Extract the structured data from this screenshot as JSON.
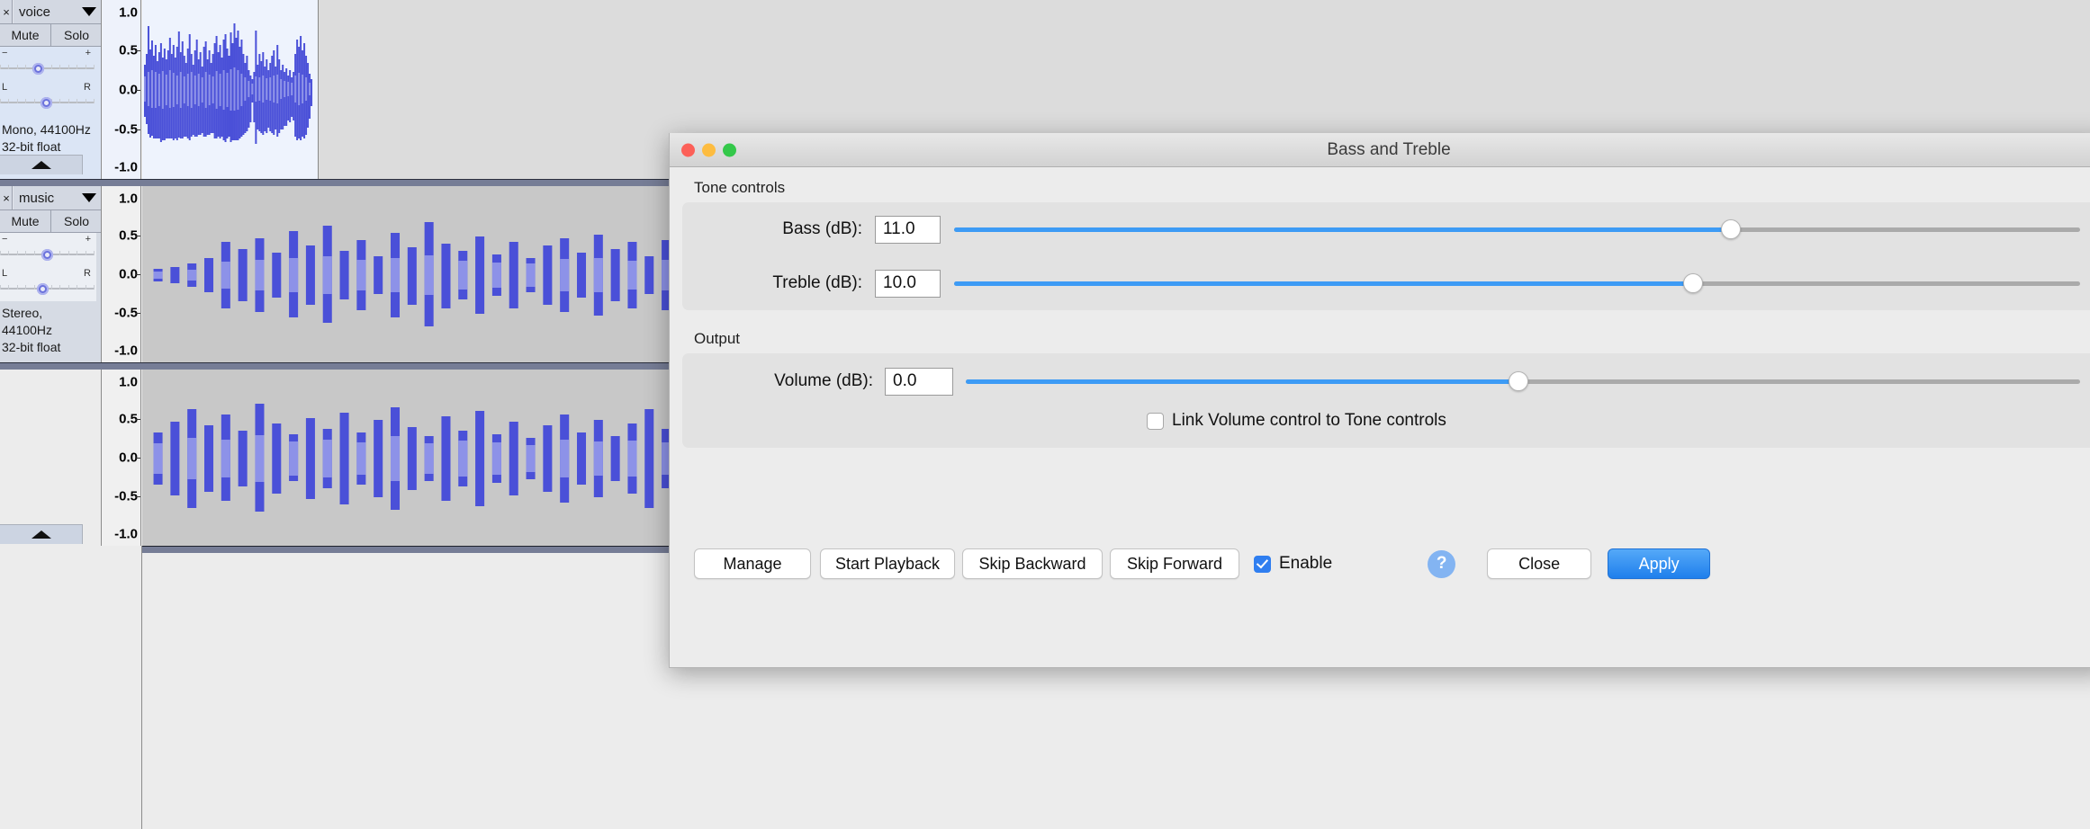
{
  "app": {
    "tracks": [
      {
        "name": "voice",
        "close_label": "×",
        "mute_label": "Mute",
        "solo_label": "Solo",
        "gain": {
          "left_label": "−",
          "right_label": "+",
          "value_pct": 38
        },
        "pan": {
          "left_label": "L",
          "right_label": "R",
          "value_pct": 47
        },
        "info_line1": "Mono, 44100Hz",
        "info_line2": "32-bit float",
        "selected": true
      },
      {
        "name": "music",
        "close_label": "×",
        "mute_label": "Mute",
        "solo_label": "Solo",
        "gain": {
          "left_label": "−",
          "right_label": "+",
          "value_pct": 47
        },
        "pan": {
          "left_label": "L",
          "right_label": "R",
          "value_pct": 43
        },
        "info_line1": "Stereo, 44100Hz",
        "info_line2": "32-bit float",
        "selected": false
      },
      {
        "name": "",
        "close_label": "",
        "mute_label": "",
        "solo_label": "",
        "info_line1": "",
        "info_line2": "",
        "selected": false
      }
    ],
    "ruler_ticks": [
      "1.0",
      "0.5",
      "0.0",
      "-0.5",
      "-1.0"
    ]
  },
  "dialog": {
    "title": "Bass and Treble",
    "traffic_lights": [
      "close-red",
      "minimize-yellow",
      "zoom-green"
    ],
    "sections": {
      "tone": {
        "label": "Tone controls",
        "controls": [
          {
            "label": "Bass (dB):",
            "value": "11.0",
            "slider_pct": 69
          },
          {
            "label": "Treble (dB):",
            "value": "10.0",
            "slider_pct": 65.6
          }
        ]
      },
      "output": {
        "label": "Output",
        "controls": [
          {
            "label": "Volume (dB):",
            "value": "0.0",
            "slider_pct": 49.6
          }
        ],
        "link_checkbox": {
          "label": "Link Volume control to Tone controls",
          "checked": false
        }
      }
    },
    "footer": {
      "manage_label": "Manage",
      "start_playback_label": "Start Playback",
      "skip_backward_label": "Skip Backward",
      "skip_forward_label": "Skip Forward",
      "enable_label": "Enable",
      "enable_checked": true,
      "help_label": "?",
      "close_label": "Close",
      "apply_label": "Apply"
    }
  },
  "colors": {
    "accent_blue": "#3d9bf5",
    "apply_blue": "#2f8bf0",
    "waveform_envelope": "#8d92e8",
    "waveform_peak": "#4a50d8",
    "selected_track_bg": "#eef3fd",
    "unselected_track_bg": "#c8c8c8"
  }
}
